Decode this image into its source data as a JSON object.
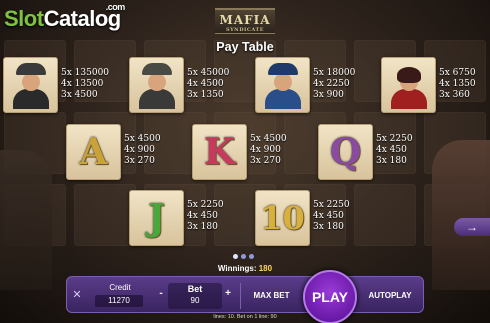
{
  "watermark": {
    "slot": "Slot",
    "catalog": "Catalog",
    "com": ".com"
  },
  "game_logo": {
    "name": "MAFIA",
    "sub": "SYNDICATE"
  },
  "title": "Pay Table",
  "symbols_row1": [
    {
      "name": "boss",
      "colors": {
        "hat": "#3a3a3a",
        "body": "#2a2a2a"
      },
      "pays": [
        "5x 135000",
        "4x 13500",
        "3x 4500"
      ]
    },
    {
      "name": "gunman",
      "colors": {
        "hat": "#4a4a44",
        "body": "#3a3a38"
      },
      "pays": [
        "5x 45000",
        "4x 4500",
        "3x 1350"
      ]
    },
    {
      "name": "cop",
      "colors": {
        "hat": "#1e3a6a",
        "body": "#2a4e8a"
      },
      "pays": [
        "5x 18000",
        "4x 2250",
        "3x 900"
      ]
    },
    {
      "name": "lady",
      "colors": {
        "hat": "#3a1a18",
        "body": "#a02020"
      },
      "pays": [
        "5x 6750",
        "4x 1350",
        "3x 360"
      ]
    }
  ],
  "symbols_row2": [
    {
      "name": "A",
      "color": "#c9a33a",
      "pays": [
        "5x 4500",
        "4x 900",
        "3x 270"
      ]
    },
    {
      "name": "K",
      "color": "#c73a5e",
      "pays": [
        "5x 4500",
        "4x 900",
        "3x 270"
      ]
    },
    {
      "name": "Q",
      "color": "#8a4aa0",
      "pays": [
        "5x 2250",
        "4x 450",
        "3x 180"
      ]
    }
  ],
  "symbols_row3": [
    {
      "name": "J",
      "color": "#4aa83a",
      "pays": [
        "5x 2250",
        "4x 450",
        "3x 180"
      ]
    },
    {
      "name": "10",
      "color": "#d8b03a",
      "pays": [
        "5x 2250",
        "4x 450",
        "3x 180"
      ]
    }
  ],
  "pagination": {
    "current": 1,
    "total": 3
  },
  "winnings": {
    "label": "Winnings:",
    "value": "180"
  },
  "controls": {
    "close": "✕",
    "credit_label": "Credit",
    "credit_value": "11270",
    "bet_minus": "-",
    "bet_plus": "+",
    "bet_label": "Bet",
    "bet_value": "90",
    "max_bet": "MAX BET",
    "play": "PLAY",
    "autoplay": "AUTOPLAY"
  },
  "footer": "lines: 10.   Bet on 1 line: 90",
  "next_arrow": "→"
}
